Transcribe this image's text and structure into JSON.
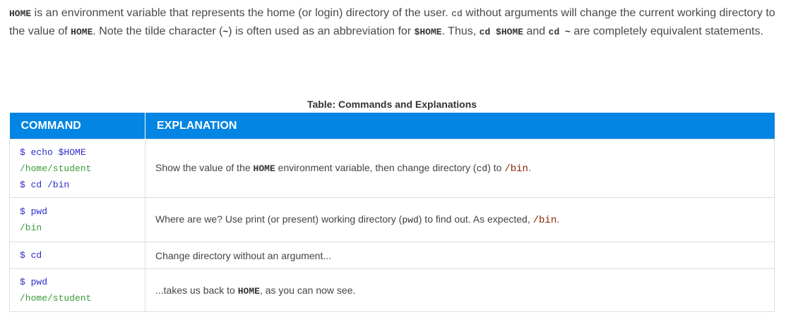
{
  "intro": {
    "home_code_1": "HOME",
    "text_1": " is an environment variable that represents the home (or login) directory of the user. ",
    "cd_code_1": "cd",
    "text_2": " without arguments will change the current working directory to the value of ",
    "home_code_2": "HOME",
    "text_3": ". Note the tilde character (",
    "tilde": "~",
    "text_4": ") is often used as an abbreviation for ",
    "home_var": "$HOME",
    "text_5": ". Thus, ",
    "cd_home": "cd $HOME",
    "text_6": " and ",
    "cd_tilde": "cd ~",
    "text_7": " are completely equivalent statements."
  },
  "table": {
    "caption": "Table: Commands and Explanations",
    "headers": {
      "command": "COMMAND",
      "explanation": "EXPLANATION"
    },
    "rows": [
      {
        "lines": [
          {
            "text": "$ echo $HOME",
            "kind": "prompt"
          },
          {
            "text": "/home/student",
            "kind": "output"
          },
          {
            "text": "$ cd /bin",
            "kind": "prompt"
          }
        ],
        "exp": {
          "t1": "Show the value of the ",
          "c1": "HOME",
          "t2": " environment variable, then change directory (",
          "c2": "cd",
          "t3": ") to ",
          "p1": "/bin",
          "t4": "."
        }
      },
      {
        "lines": [
          {
            "text": "$ pwd",
            "kind": "prompt"
          },
          {
            "text": "/bin",
            "kind": "output"
          }
        ],
        "exp": {
          "t1": "Where are we? Use print (or present) working directory (",
          "c1": "pwd",
          "t2": ") to find out. As expected, ",
          "p1": "/bin",
          "t3": "."
        }
      },
      {
        "lines": [
          {
            "text": "$ cd",
            "kind": "prompt"
          }
        ],
        "exp": {
          "t1": "Change directory without an argument..."
        }
      },
      {
        "lines": [
          {
            "text": "$ pwd",
            "kind": "prompt"
          },
          {
            "text": "/home/student",
            "kind": "output"
          }
        ],
        "exp": {
          "t1": "...takes us back to ",
          "c1": "HOME",
          "t2": ", as you can now see."
        }
      }
    ]
  }
}
